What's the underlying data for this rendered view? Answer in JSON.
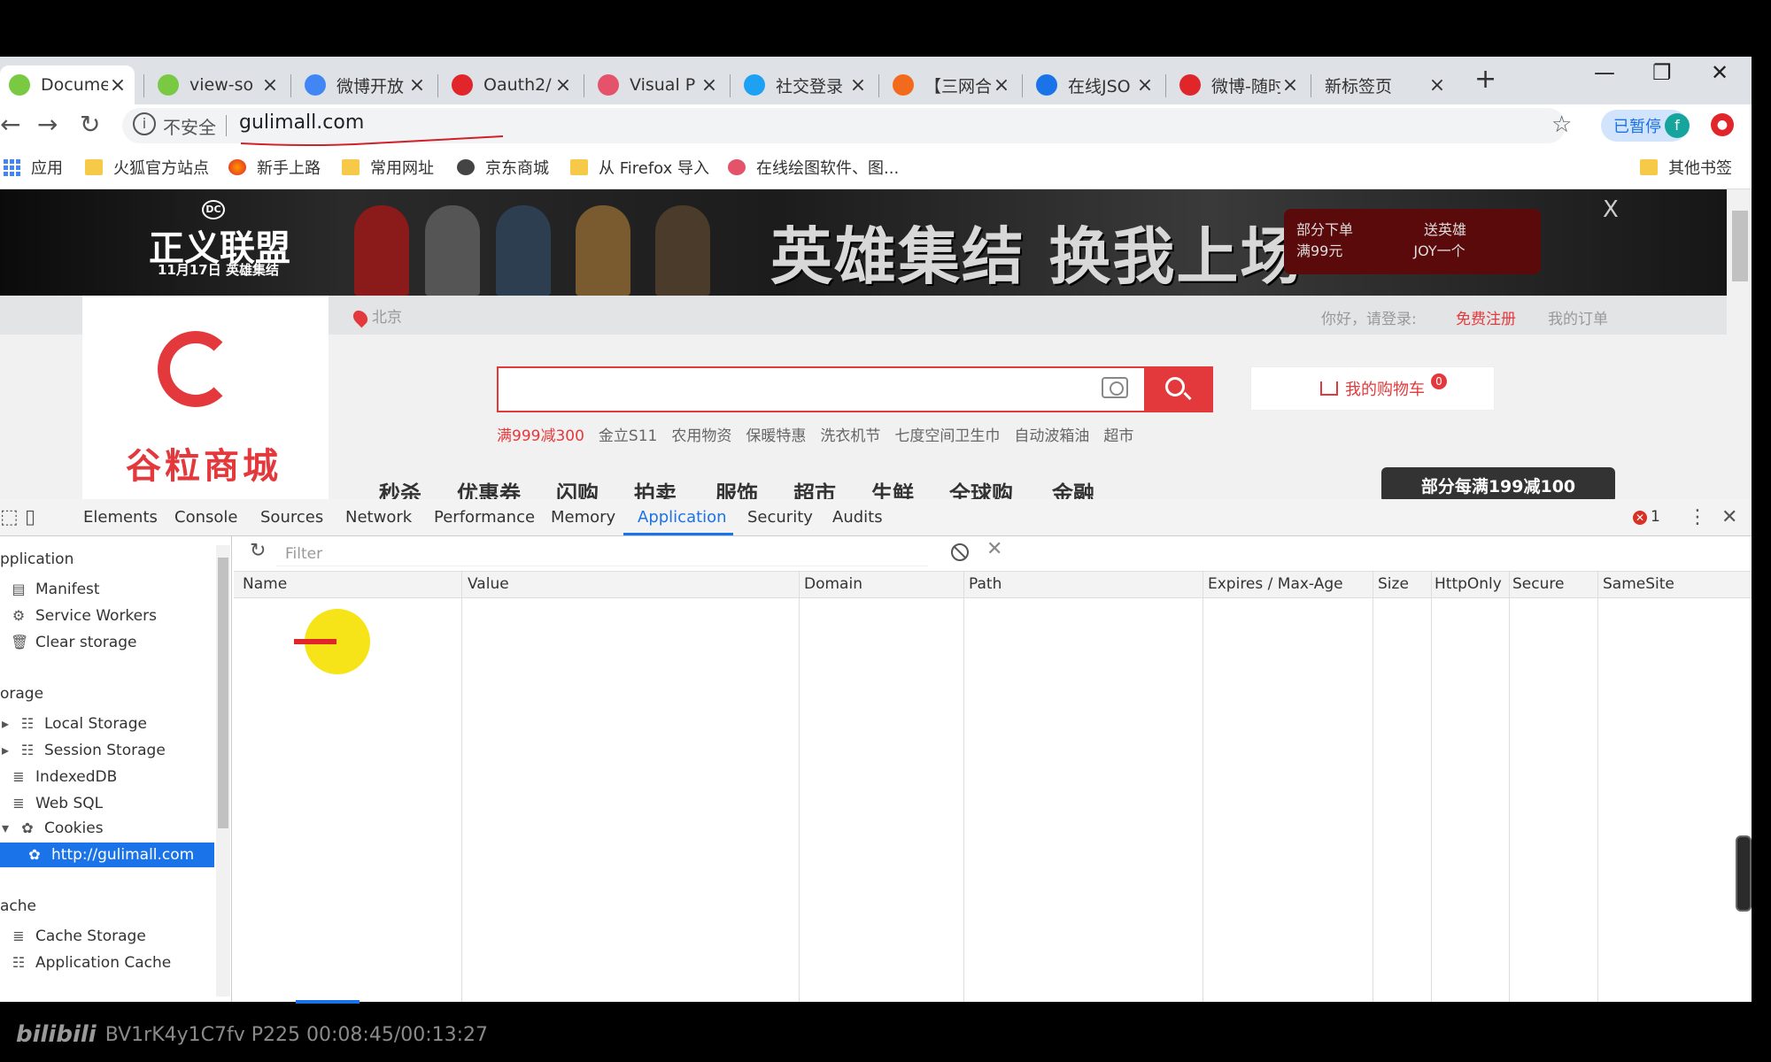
{
  "tabs": [
    {
      "label": "Docume",
      "color": "#7ac943"
    },
    {
      "label": "view-so",
      "color": "#7ac943"
    },
    {
      "label": "微博开放",
      "color": "#4285f4"
    },
    {
      "label": "Oauth2/",
      "color": "#e0262a"
    },
    {
      "label": "Visual P",
      "color": "#e5536a"
    },
    {
      "label": "社交登录",
      "color": "#1ea1f2"
    },
    {
      "label": "【三网合",
      "color": "#f26b1d"
    },
    {
      "label": "在线JSO",
      "color": "#1a73e8"
    },
    {
      "label": "微博-随时",
      "color": "#e0262a"
    },
    {
      "label": "新标签页",
      "color": ""
    }
  ],
  "toolbar": {
    "insecure_label": "不安全",
    "url": "gulimall.com",
    "paused_label": "已暂停",
    "avatar_letter": "f"
  },
  "bookmarks": [
    {
      "label": "应用",
      "icon": "apps-grid-icon"
    },
    {
      "label": "火狐官方站点",
      "icon": "folder-icon"
    },
    {
      "label": "新手上路",
      "icon": "firefox-icon"
    },
    {
      "label": "常用网址",
      "icon": "folder-icon"
    },
    {
      "label": "京东商城",
      "icon": "globe-icon"
    },
    {
      "label": "从 Firefox 导入",
      "icon": "folder-icon"
    },
    {
      "label": "在线绘图软件、图...",
      "icon": "site-icon"
    },
    {
      "label": "其他书签",
      "icon": "folder-icon"
    }
  ],
  "page": {
    "banner": {
      "brand": "正义联盟",
      "brand_sub": "11月17日 英雄集结",
      "dc": "DC",
      "slogan": "英雄集结 换我上场",
      "promo_line1": "部分下单",
      "promo_line2": "满99元",
      "promo_line3": "送英雄",
      "promo_line4": "JOY一个",
      "close": "X"
    },
    "location": "北京",
    "greeting": "你好，请登录:",
    "register": "免费注册",
    "orders": "我的订单",
    "logo_text": "谷粒商城",
    "hotwords": [
      "满999减300",
      "金立S11",
      "农用物资",
      "保暖特惠",
      "洗衣机节",
      "七度空间卫生巾",
      "自动波箱油",
      "超市"
    ],
    "cart_label": "我的购物车",
    "cart_count": "0",
    "categories": [
      "秒杀",
      "优惠券",
      "闪购",
      "拍卖",
      "服饰",
      "超市",
      "生鲜",
      "全球购",
      "金融"
    ],
    "promo_tag": "部分每满199减100"
  },
  "devtools": {
    "tabs": [
      "Elements",
      "Console",
      "Sources",
      "Network",
      "Performance",
      "Memory",
      "Application",
      "Security",
      "Audits"
    ],
    "active_tab": "Application",
    "error_count": "1",
    "sidebar": {
      "application_header": "pplication",
      "application_items": [
        "Manifest",
        "Service Workers",
        "Clear storage"
      ],
      "storage_header": "orage",
      "storage_items": [
        "Local Storage",
        "Session Storage",
        "IndexedDB",
        "Web SQL",
        "Cookies"
      ],
      "cookie_origin": "http://gulimall.com",
      "cache_header": "ache",
      "cache_items": [
        "Cache Storage",
        "Application Cache"
      ]
    },
    "filter_placeholder": "Filter",
    "columns": [
      "Name",
      "Value",
      "Domain",
      "Path",
      "Expires / Max-Age",
      "Size",
      "HttpOnly",
      "Secure",
      "SameSite"
    ]
  },
  "watermark": {
    "logo": "bilibili",
    "text": "BV1rK4y1C7fv P225 00:08:45/00:13:27"
  }
}
